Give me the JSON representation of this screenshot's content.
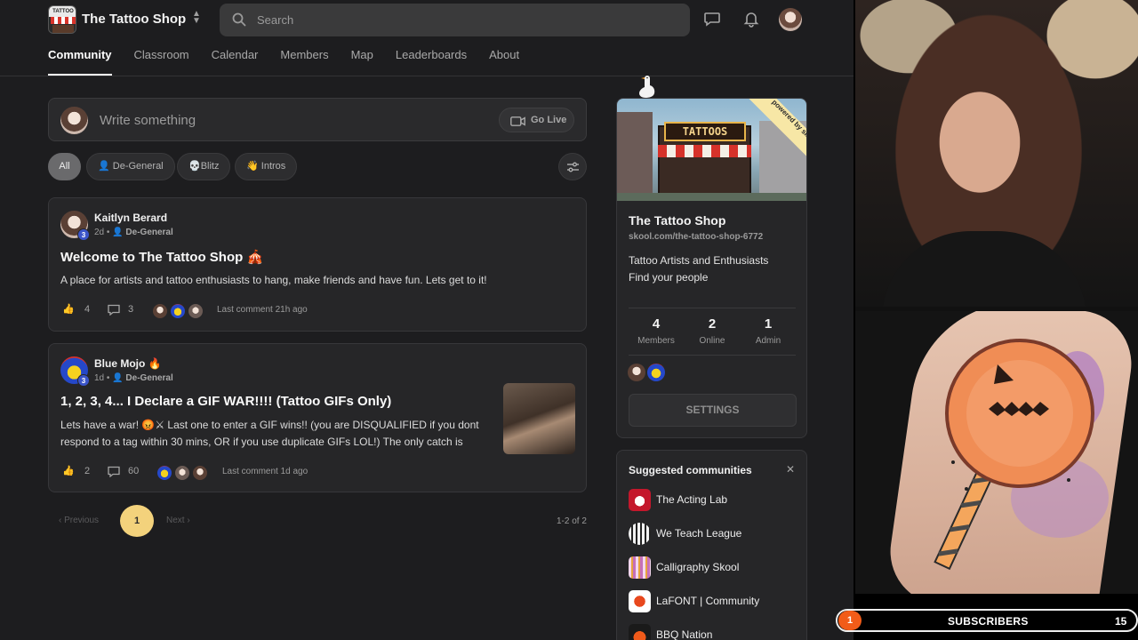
{
  "header": {
    "group_name": "The Tattoo Shop",
    "logo_text": "TATTOO",
    "search_placeholder": "Search"
  },
  "tabs": [
    {
      "label": "Community",
      "active": true
    },
    {
      "label": "Classroom"
    },
    {
      "label": "Calendar"
    },
    {
      "label": "Members"
    },
    {
      "label": "Map"
    },
    {
      "label": "Leaderboards"
    },
    {
      "label": "About"
    }
  ],
  "composer": {
    "placeholder": "Write something",
    "go_live_label": "Go Live"
  },
  "filters": [
    {
      "label": "All",
      "active": true
    },
    {
      "label": "De-General",
      "emoji": "👤"
    },
    {
      "label": "Blitz",
      "emoji": "💀"
    },
    {
      "label": "Intros",
      "emoji": "👋"
    }
  ],
  "posts": [
    {
      "author": "Kaitlyn Berard",
      "level": "3",
      "time": "2d",
      "category": "De-General",
      "title": "Welcome to The Tattoo Shop 🎪",
      "body": "A place for artists and tattoo enthusiasts to hang, make friends and have fun. Lets get to it!",
      "likes": "4",
      "comments": "3",
      "last_comment": "Last comment 21h ago"
    },
    {
      "author": "Blue Mojo 🔥",
      "level": "3",
      "time": "1d",
      "category": "De-General",
      "title": "1, 2, 3, 4... I Declare a GIF WAR!!!! (Tattoo GIFs Only)",
      "body_line1": "Lets have a war! 😡⚔ Last one to enter a GIF wins!! (you are DISQUALIFIED if you dont",
      "body_line2": "respond to a tag within 30 mins, OR if you use duplicate GIFs LOL!) The only catch is",
      "likes": "2",
      "comments": "60",
      "last_comment": "Last comment 1d ago"
    }
  ],
  "pagination": {
    "previous_label": "Previous",
    "next_label": "Next",
    "current_page": "1",
    "range_text": "1-2 of 2"
  },
  "about": {
    "cover_sign": "TATTOOS",
    "ribbon": "powered by skool",
    "name": "The Tattoo Shop",
    "url": "skool.com/the-tattoo-shop-6772",
    "description_line1": "Tattoo Artists and Enthusiasts",
    "description_line2": "Find your people",
    "stats": [
      {
        "value": "4",
        "label": "Members"
      },
      {
        "value": "2",
        "label": "Online"
      },
      {
        "value": "1",
        "label": "Admin"
      }
    ],
    "settings_label": "SETTINGS"
  },
  "suggested": {
    "title": "Suggested communities",
    "close": "✕",
    "items": [
      {
        "label": "The Acting Lab",
        "color": "#c4172c"
      },
      {
        "label": "We Teach League",
        "color": "#f2f2f2"
      },
      {
        "label": "Calligraphy Skool",
        "color": "#f4d7ef"
      },
      {
        "label": "LaFONT | Community",
        "color": "#ffffff"
      },
      {
        "label": "BBQ Nation",
        "color": "#1a1a1a"
      }
    ]
  },
  "overlay": {
    "subscriber_count": "1",
    "subscribers_label": "SUBSCRIBERS",
    "subscriber_goal": "15"
  },
  "colors": {
    "background": "#1d1d1f",
    "card": "#262628",
    "page_active": "#f3d27c",
    "level_badge": "#3b55c9",
    "subscriber_dot": "#f25c19"
  }
}
